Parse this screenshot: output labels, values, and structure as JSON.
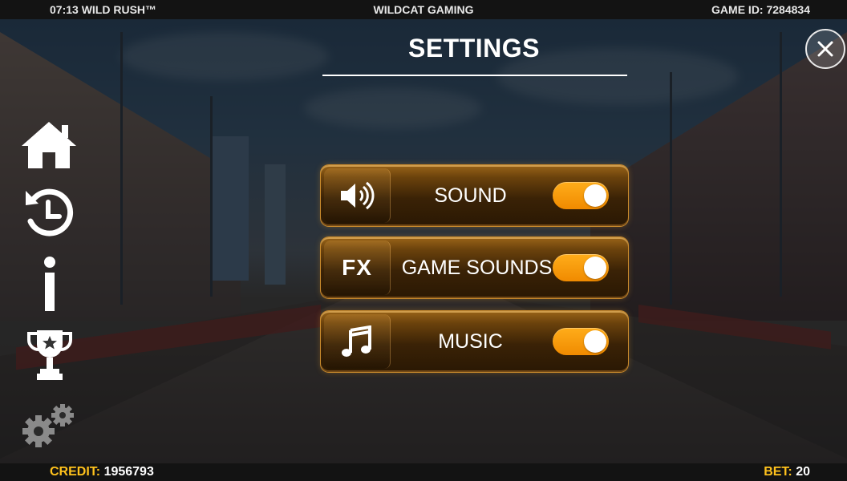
{
  "topbar": {
    "time_game": "07:13 WILD RUSH™",
    "provider": "WILDCAT GAMING",
    "game_id": "GAME ID: 7284834"
  },
  "settings": {
    "title": "SETTINGS",
    "rows": [
      {
        "label": "SOUND",
        "icon": "speaker-icon",
        "enabled": true
      },
      {
        "label": "GAME SOUNDS",
        "icon": "fx-icon",
        "icon_text": "FX",
        "enabled": true
      },
      {
        "label": "MUSIC",
        "icon": "music-note-icon",
        "enabled": true
      }
    ]
  },
  "side_menu": [
    "home-icon",
    "history-icon",
    "info-icon",
    "trophy-icon",
    "settings-gears-icon"
  ],
  "bottombar": {
    "credit_label": "CREDIT:",
    "credit_value": "1956793",
    "bet_label": "BET:",
    "bet_value": "20"
  },
  "colors": {
    "accent_yellow": "#ffc21c",
    "toggle_on": "#f7990b",
    "row_border": "#c98a2c"
  }
}
